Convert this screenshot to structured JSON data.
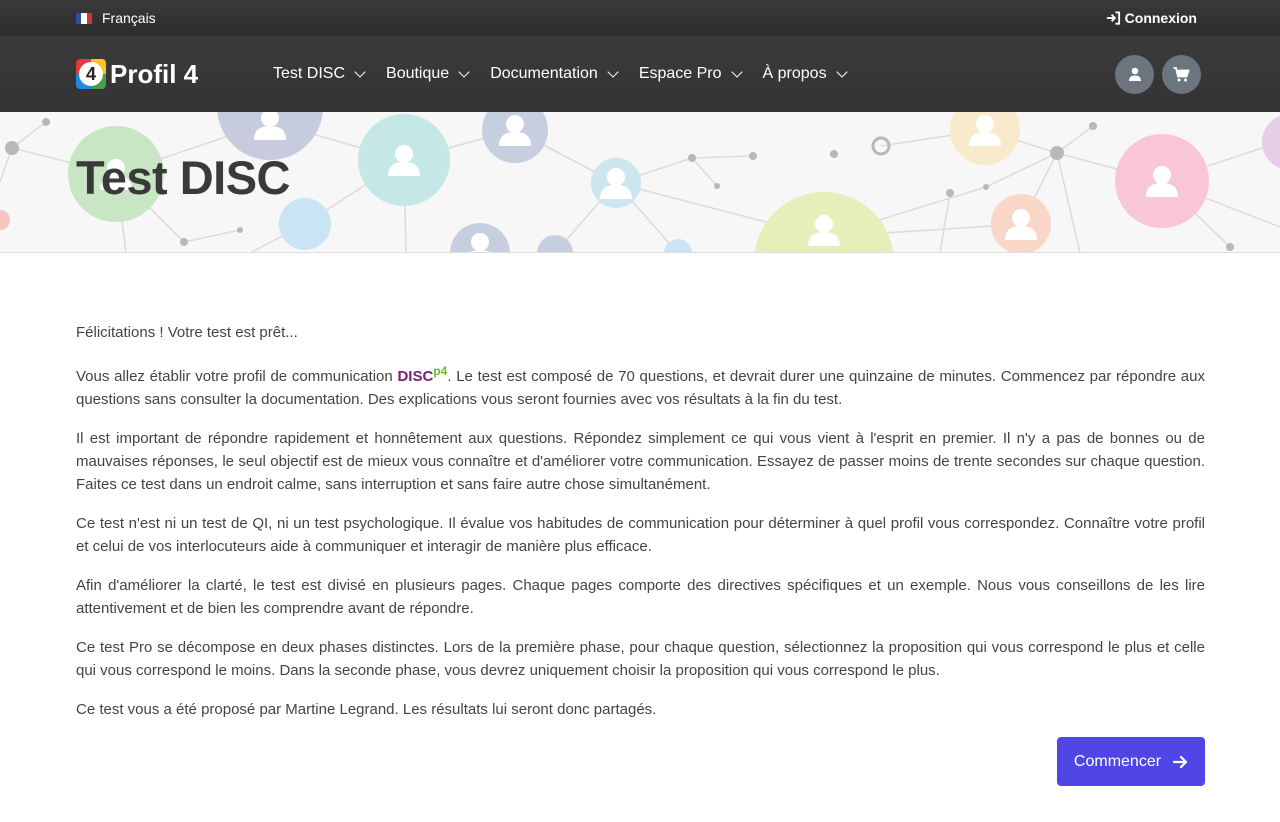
{
  "topbar": {
    "language": "Français",
    "login_label": "Connexion"
  },
  "navbar": {
    "brand": "Profil 4",
    "logo_number": "4",
    "menu": [
      {
        "label": "Test DISC"
      },
      {
        "label": "Boutique"
      },
      {
        "label": "Documentation"
      },
      {
        "label": "Espace Pro"
      },
      {
        "label": "À propos"
      }
    ]
  },
  "banner": {
    "title": "Test DISC"
  },
  "content": {
    "intro": "Félicitations ! Votre test est prêt...",
    "p1_before": "Vous allez établir votre profil de communication ",
    "disc_brand": "DISC",
    "disc_sup": "p4",
    "p1_after": ". Le test est composé de 70 questions, et devrait durer une quinzaine de minutes. Commencez par répondre aux questions sans consulter la documentation. Des explications vous seront fournies avec vos résultats à la fin du test.",
    "p2": "Il est important de répondre rapidement et honnêtement aux questions. Répondez simplement ce qui vous vient à l'esprit en premier. Il n'y a pas de bonnes ou de mauvaises réponses, le seul objectif est de mieux vous connaître et d'améliorer votre communication. Essayez de passer moins de trente secondes sur chaque question. Faites ce test dans un endroit calme, sans interruption et sans faire autre chose simultanément.",
    "p3": "Ce test n'est ni un test de QI, ni un test psychologique. Il évalue vos habitudes de communication pour déterminer à quel profil vous correspondez. Connaître votre profil et celui de vos interlocuteurs aide à communiquer et interagir de manière plus efficace.",
    "p4": "Afin d'améliorer la clarté, le test est divisé en plusieurs pages. Chaque pages comporte des directives spécifiques et un exemple. Nous vous conseillons de les lire attentivement et de bien les comprendre avant de répondre.",
    "p5": "Ce test Pro se décompose en deux phases distinctes. Lors de la première phase, pour chaque question, sélectionnez la proposition qui vous correspond le plus et celle qui vous correspond le moins. Dans la seconde phase, vous devrez uniquement choisir la proposition qui vous correspond le plus.",
    "p6": "Ce test vous a été proposé par Martine Legrand. Les résultats lui seront donc partagés.",
    "start_label": "Commencer"
  },
  "icons": {
    "flag": "france-flag-icon",
    "login": "sign-in-icon",
    "user": "user-icon",
    "cart": "cart-icon",
    "arrow": "arrow-right-icon"
  },
  "colors": {
    "primary_button": "#4f46e5",
    "disc_brand": "#7a1b7e",
    "disc_sup": "#6bbd2a",
    "navbar": "#333333"
  }
}
